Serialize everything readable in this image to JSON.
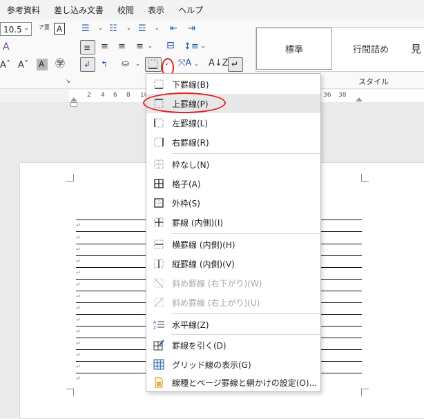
{
  "menubar": {
    "items": [
      "参考資料",
      "差し込み文書",
      "校閲",
      "表示",
      "ヘルプ"
    ]
  },
  "ribbon": {
    "font_size": "10.5",
    "style_gallery": [
      "標準",
      "行間詰め",
      "見"
    ],
    "group_label_styles": "スタイル"
  },
  "ruler": {
    "ticks": [
      "2",
      "4",
      "6",
      "8",
      "10",
      "36",
      "38"
    ]
  },
  "document": {
    "paragraph_mark": "↵"
  },
  "border_menu": {
    "items": [
      {
        "label": "下罫線(B)",
        "icon": "border-bottom-icon"
      },
      {
        "label": "上罫線(P)",
        "icon": "border-top-icon"
      },
      {
        "label": "左罫線(L)",
        "icon": "border-left-icon"
      },
      {
        "label": "右罫線(R)",
        "icon": "border-right-icon"
      },
      {
        "label": "枠なし(N)",
        "icon": "no-border-icon"
      },
      {
        "label": "格子(A)",
        "icon": "all-borders-icon"
      },
      {
        "label": "外枠(S)",
        "icon": "outside-borders-icon"
      },
      {
        "label": "罫線 (内側)(I)",
        "icon": "inside-borders-icon"
      },
      {
        "label": "横罫線 (内側)(H)",
        "icon": "inside-horizontal-border-icon"
      },
      {
        "label": "縦罫線 (内側)(V)",
        "icon": "inside-vertical-border-icon"
      },
      {
        "label": "斜め罫線 (右下がり)(W)",
        "icon": "diagonal-down-border-icon"
      },
      {
        "label": "斜め罫線 (右上がり)(U)",
        "icon": "diagonal-up-border-icon"
      },
      {
        "label": "水平線(Z)",
        "icon": "horizontal-line-icon"
      },
      {
        "label": "罫線を引く(D)",
        "icon": "draw-table-icon"
      },
      {
        "label": "グリッド線の表示(G)",
        "icon": "view-gridlines-icon"
      },
      {
        "label": "線種とページ罫線と網かけの設定(O)...",
        "icon": "borders-and-shading-icon"
      }
    ],
    "disabled": [
      "斜め罫線 (右下がり)(W)",
      "斜め罫線 (右上がり)(U)"
    ],
    "highlighted": "上罫線(P)"
  },
  "colors": {
    "annotation_red": "#e0201e",
    "accent_blue": "#1f5aa8"
  }
}
